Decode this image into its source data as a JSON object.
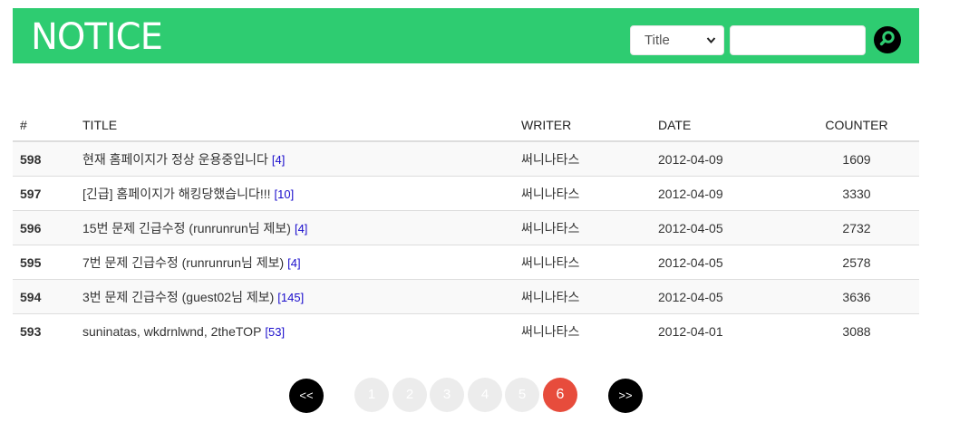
{
  "header": {
    "title": "NOTICE",
    "search_field_selected": "Title",
    "search_input_value": "",
    "search_icon": "search-icon",
    "color": "#2ecc71"
  },
  "table": {
    "columns": [
      "#",
      "TITLE",
      "WRITER",
      "DATE",
      "COUNTER"
    ],
    "rows": [
      {
        "num": "598",
        "title": "현재 홈페이지가 정상 운용중입니다",
        "comments": "[4]",
        "writer": "써니나타스",
        "date": "2012-04-09",
        "counter": "1609"
      },
      {
        "num": "597",
        "title": "[긴급] 홈페이지가 해킹당했습니다!!!",
        "comments": "[10]",
        "writer": "써니나타스",
        "date": "2012-04-09",
        "counter": "3330"
      },
      {
        "num": "596",
        "title": "15번 문제 긴급수정 (runrunrun님 제보)",
        "comments": "[4]",
        "writer": "써니나타스",
        "date": "2012-04-05",
        "counter": "2732"
      },
      {
        "num": "595",
        "title": "7번 문제 긴급수정 (runrunrun님 제보)",
        "comments": "[4]",
        "writer": "써니나타스",
        "date": "2012-04-05",
        "counter": "2578"
      },
      {
        "num": "594",
        "title": "3번 문제 긴급수정 (guest02님 제보)",
        "comments": "[145]",
        "writer": "써니나타스",
        "date": "2012-04-05",
        "counter": "3636"
      },
      {
        "num": "593",
        "title": "suninatas, wkdrnlwnd, 2theTOP",
        "comments": "[53]",
        "writer": "써니나타스",
        "date": "2012-04-01",
        "counter": "3088"
      }
    ]
  },
  "pagination": {
    "prev_label": "<<",
    "next_label": ">>",
    "pages": [
      "1",
      "2",
      "3",
      "4",
      "5",
      "6"
    ],
    "current": "6",
    "active_color": "#e74c3c"
  }
}
